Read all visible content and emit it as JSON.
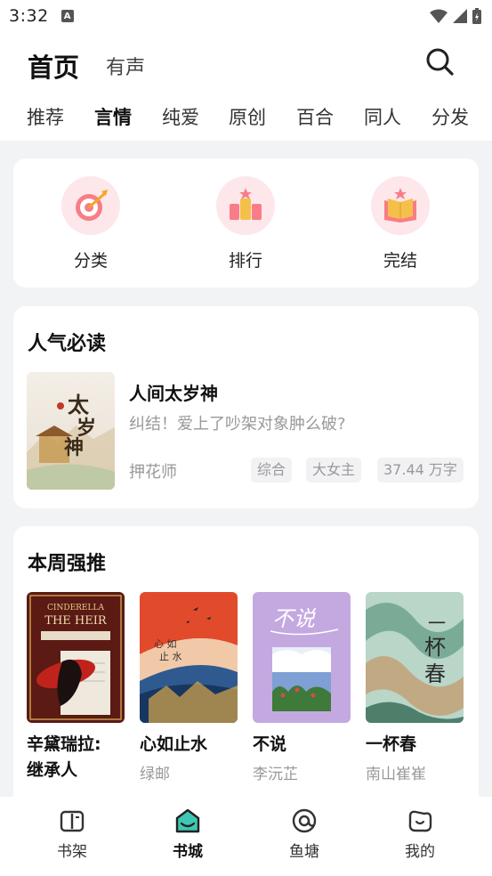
{
  "status_bar": {
    "time": "3:32",
    "notification_badge": "A"
  },
  "header": {
    "title_home": "首页",
    "title_audio": "有声",
    "tabs": [
      {
        "label": "推荐",
        "active": false
      },
      {
        "label": "言情",
        "active": true
      },
      {
        "label": "纯爱",
        "active": false
      },
      {
        "label": "原创",
        "active": false
      },
      {
        "label": "百合",
        "active": false
      },
      {
        "label": "同人",
        "active": false
      },
      {
        "label": "分发",
        "active": false
      }
    ]
  },
  "categories": [
    {
      "label": "分类",
      "icon": "target-icon"
    },
    {
      "label": "排行",
      "icon": "ranking-icon"
    },
    {
      "label": "完结",
      "icon": "completed-book-icon"
    }
  ],
  "popular": {
    "section_title": "人气必读",
    "book": {
      "title": "人间太岁神",
      "description": "纠结！爱上了吵架对象肿么破?",
      "author": "押花师",
      "tags": [
        "综合",
        "大女主",
        "37.44 万字"
      ],
      "cover_text": "太岁神"
    }
  },
  "weekly": {
    "section_title": "本周强推",
    "books": [
      {
        "title_line1": "辛黛瑞拉:",
        "title_line2": "继承人",
        "author": "",
        "cover_text": "CINDERELLA THE HEIR"
      },
      {
        "title_line1": "心如止水",
        "title_line2": "",
        "author": "绿邮",
        "cover_text": "心如止水"
      },
      {
        "title_line1": "不说",
        "title_line2": "",
        "author": "李沅芷",
        "cover_text": "不说"
      },
      {
        "title_line1": "一杯春",
        "title_line2": "",
        "author": "南山崔崔",
        "cover_text": "一杯春"
      }
    ]
  },
  "bottom_nav": [
    {
      "label": "书架",
      "icon": "bookshelf-icon",
      "active": false
    },
    {
      "label": "书城",
      "icon": "bookstore-icon",
      "active": true
    },
    {
      "label": "鱼塘",
      "icon": "fishpond-icon",
      "active": false
    },
    {
      "label": "我的",
      "icon": "profile-icon",
      "active": false
    }
  ],
  "colors": {
    "accent": "#3ec7b3",
    "tab_underline": "#7dd6c9",
    "icon_bg": "#fde7ea",
    "muted_text": "#999999"
  }
}
